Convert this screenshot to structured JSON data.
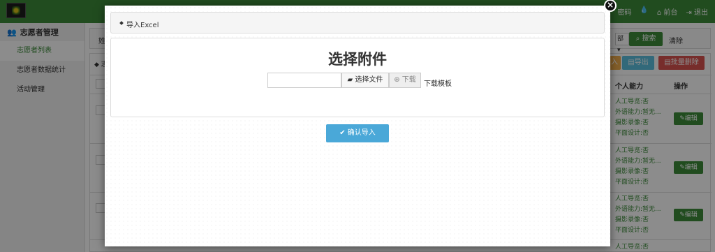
{
  "app": {
    "top_links": [
      "密码",
      "",
      "前台",
      "退出"
    ],
    "sidebar": {
      "group_label": "志愿者管理",
      "items": [
        {
          "label": "志愿者列表",
          "active": true
        },
        {
          "label": "志愿者数据统计",
          "active": false
        },
        {
          "label": "活动管理",
          "active": false
        }
      ]
    },
    "filter": {
      "label": "姓",
      "select_value": "部",
      "search_label": "搜索",
      "clear_label": "清除"
    },
    "panel": {
      "head_text": "志",
      "orange_label": "入",
      "export_label": "导出",
      "batch_delete_label": "批量删除"
    },
    "table": {
      "headers": {
        "ability": "个人能力",
        "action": "操作"
      },
      "edit_label": "编辑",
      "rows": [
        {
          "ability": [
            "人工导览:否",
            "外语能力:暂无...",
            "摄影录像:否",
            "平面设计:否"
          ]
        },
        {
          "ability": [
            "人工导览:否",
            "外语能力:暂无...",
            "摄影录像:否",
            "平面设计:否"
          ]
        },
        {
          "ability": [
            "人工导览:否",
            "外语能力:暂无...",
            "摄影录像:否",
            "平面设计:否"
          ]
        },
        {
          "ability": [
            "人工导览:否"
          ]
        }
      ]
    }
  },
  "modal": {
    "breadcrumb": "导入Excel",
    "title": "选择附件",
    "file_value": "",
    "choose_label": "选择文件",
    "download_label": "下载",
    "template_label": "下载模板",
    "confirm_label": "确认导入",
    "close_glyph": "×"
  },
  "colors": {
    "brand_green": "#3c8b3a",
    "confirm_blue": "#4aa8d8",
    "export_blue": "#5bc0de",
    "danger_red": "#d9534f",
    "warning_orange": "#f0ad4e"
  }
}
